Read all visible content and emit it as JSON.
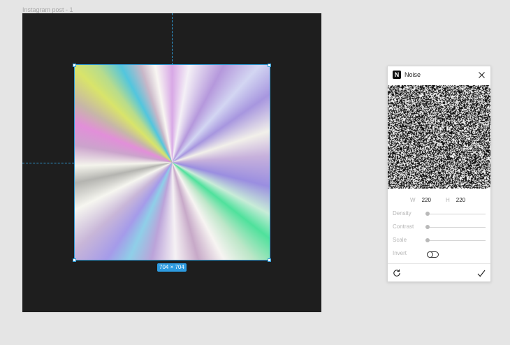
{
  "canvas": {
    "frame_label": "Instagram post - 1",
    "selection_size": "704 × 704",
    "selection_color": "#2f9bd6"
  },
  "panel": {
    "title": "Noise",
    "icons": {
      "plugin": "noise-plugin-icon",
      "close": "close-icon",
      "reset": "reset-icon",
      "apply": "checkmark-icon"
    },
    "width_label": "W",
    "width_value": "220",
    "height_label": "H",
    "height_value": "220",
    "sliders": [
      {
        "label": "Density",
        "value": 0
      },
      {
        "label": "Contrast",
        "value": 0
      },
      {
        "label": "Scale",
        "value": 0
      }
    ],
    "invert_label": "Invert",
    "invert_on": false
  }
}
